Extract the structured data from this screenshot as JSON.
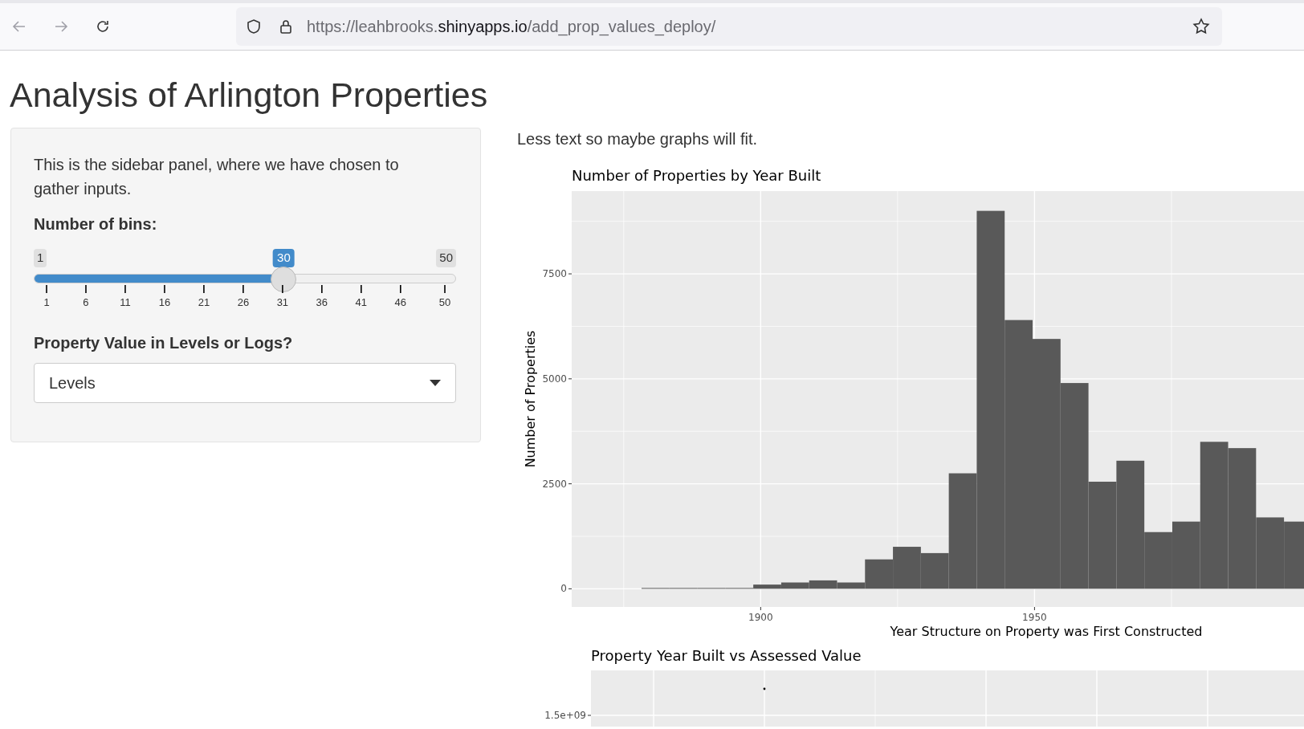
{
  "browser": {
    "url": {
      "prefix": "https://leahbrooks.",
      "domain": "shinyapps.io",
      "path": "/add_prop_values_deploy/"
    }
  },
  "title": "Analysis of Arlington Properties",
  "sidebar": {
    "intro": "This is the sidebar panel, where we have chosen to gather inputs.",
    "slider": {
      "label": "Number of bins:",
      "min": "1",
      "max": "50",
      "value": "30",
      "level": 0.592,
      "ticks": [
        "1",
        "6",
        "11",
        "16",
        "21",
        "26",
        "31",
        "36",
        "41",
        "46",
        "50"
      ]
    },
    "select": {
      "label": "Property Value in Levels or Logs?",
      "value": "Levels"
    }
  },
  "main": {
    "text": "Less text so maybe graphs will fit.",
    "histogram": {
      "chart_data": {
        "type": "bar",
        "title": "Number of Properties by Year Built",
        "xlabel": "Year Structure on Property was First Constructed",
        "ylabel": "Number of Properties",
        "x": [
          1880.8,
          1885.9,
          1891.0,
          1896.1,
          1901.2,
          1906.3,
          1911.4,
          1916.5,
          1921.6,
          1926.7,
          1931.8,
          1936.9,
          1942.0,
          1947.1,
          1952.2,
          1957.3,
          1962.4,
          1967.5,
          1972.6,
          1977.7,
          1982.8,
          1987.9,
          1993.0,
          1998.1
        ],
        "values": [
          0,
          0,
          0,
          0,
          100,
          150,
          200,
          150,
          700,
          1000,
          850,
          2750,
          9000,
          6400,
          5950,
          4900,
          2550,
          3050,
          1350,
          1600,
          3500,
          3350,
          1700,
          1600
        ],
        "grid": true,
        "xlim": [
          1865.5,
          1999.2
        ],
        "ylim": [
          -433,
          9471
        ],
        "xticks": [
          1900,
          1950
        ],
        "yticks": [
          0,
          2500,
          5000,
          7500
        ]
      }
    },
    "scatter": {
      "title": "Property Year Built vs Assessed Value",
      "ytick": "1.5e+09"
    }
  }
}
